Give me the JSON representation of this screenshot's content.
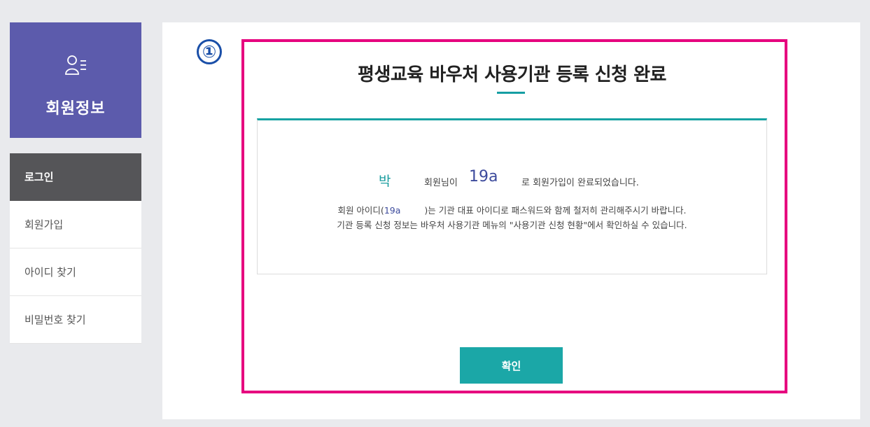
{
  "sidebar": {
    "header_icon": "member-info-icon",
    "title": "회원정보",
    "items": [
      {
        "label": "로그인",
        "active": true
      },
      {
        "label": "회원가입",
        "active": false
      },
      {
        "label": "아이디 찾기",
        "active": false
      },
      {
        "label": "비밀번호 찾기",
        "active": false
      }
    ]
  },
  "step_marker": "①",
  "main": {
    "title": "평생교육 바우처 사용기관 등록 신청 완료",
    "message": {
      "name": "박",
      "text_member": "회원님이",
      "user_id": "19a",
      "text_done": "로 회원가입이 완료되었습니다.",
      "line2_prefix": "회원 아이디(",
      "line2_id": "19a",
      "line2_suffix": ")는 기관 대표 아이디로 패스워드와 함께 철저히 관리해주시기 바랍니다.",
      "line3": "기관 등록 신청 정보는 바우처 사용기관 메뉴의 \"사용기관 신청 현황\"에서 확인하실 수 있습니다."
    },
    "confirm_label": "확인"
  },
  "colors": {
    "sidebar_header": "#5c5bac",
    "active_menu": "#555558",
    "accent_teal": "#1ba7a7",
    "highlight_frame": "#e6007e",
    "step_marker": "#1a4fa8"
  }
}
